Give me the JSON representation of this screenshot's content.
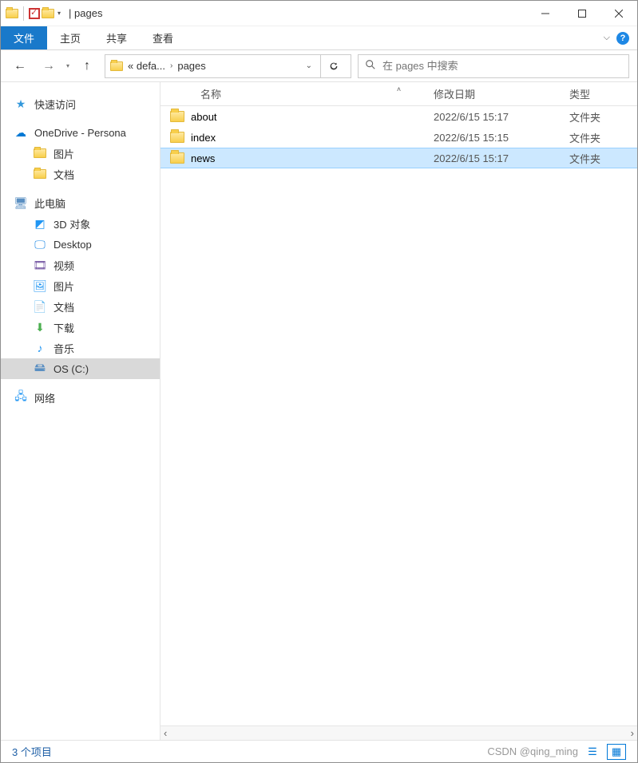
{
  "window": {
    "title": "pages",
    "separator": "|"
  },
  "ribbon": {
    "tabs": [
      "文件",
      "主页",
      "共享",
      "查看"
    ],
    "active": 0
  },
  "address": {
    "crumb_prefix": "« defa...",
    "crumb_current": "pages"
  },
  "search": {
    "placeholder": "在 pages 中搜索"
  },
  "columns": {
    "name": "名称",
    "date": "修改日期",
    "type": "类型"
  },
  "files": [
    {
      "name": "about",
      "date": "2022/6/15 15:17",
      "type": "文件夹"
    },
    {
      "name": "index",
      "date": "2022/6/15 15:15",
      "type": "文件夹"
    },
    {
      "name": "news",
      "date": "2022/6/15 15:17",
      "type": "文件夹"
    }
  ],
  "sidebar": {
    "quick": "快速访问",
    "onedrive": "OneDrive - Persona",
    "onedrive_children": [
      "图片",
      "文档"
    ],
    "thispc": "此电脑",
    "thispc_children": [
      "3D 对象",
      "Desktop",
      "视频",
      "图片",
      "文档",
      "下载",
      "音乐",
      "OS (C:)"
    ],
    "network": "网络"
  },
  "status": {
    "count": "3 个项目",
    "watermark": "CSDN @qing_ming"
  }
}
